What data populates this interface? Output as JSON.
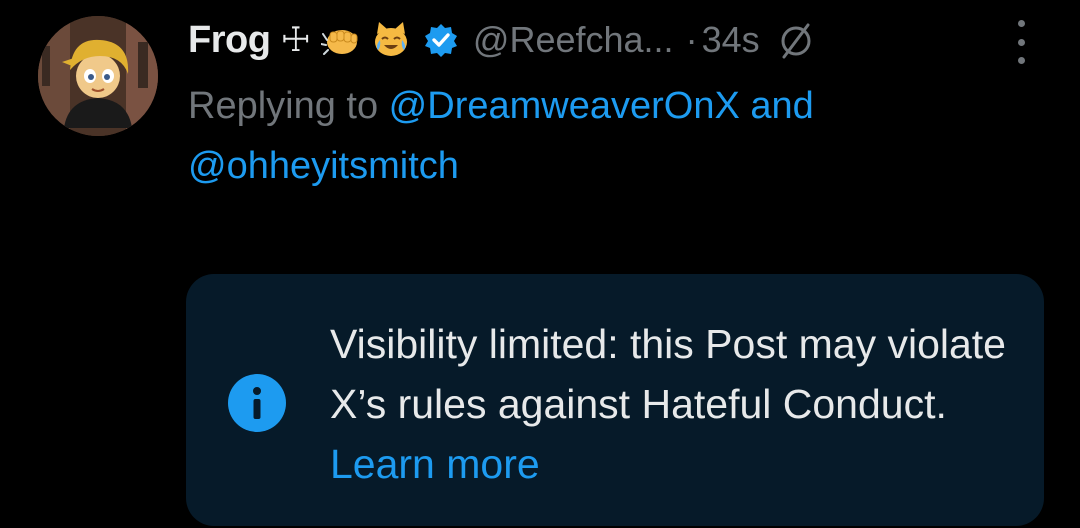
{
  "post": {
    "author": {
      "display_name": "Frog",
      "name_icons": [
        "cross-icon",
        "punch-emoji-icon",
        "cat-tears-of-joy-emoji-icon"
      ],
      "cross_glyph": "☩",
      "verified": true,
      "handle": "@Reefcha...",
      "separator": "·",
      "time": "34s"
    },
    "reply": {
      "prefix": "Replying to ",
      "mention_1": "@DreamweaverOnX",
      "joiner": " and",
      "mention_2": "@ohheyitsmitch"
    },
    "text": ""
  },
  "notice": {
    "text": "Visibility limited: this Post may violate X’s rules against Hateful Conduct. ",
    "link": "Learn more",
    "icon": "info-icon"
  },
  "colors": {
    "background": "#000000",
    "primary_text": "#e7e9ea",
    "secondary_text": "#71767b",
    "accent": "#1d9bf0",
    "notice_background": "#061a29"
  }
}
